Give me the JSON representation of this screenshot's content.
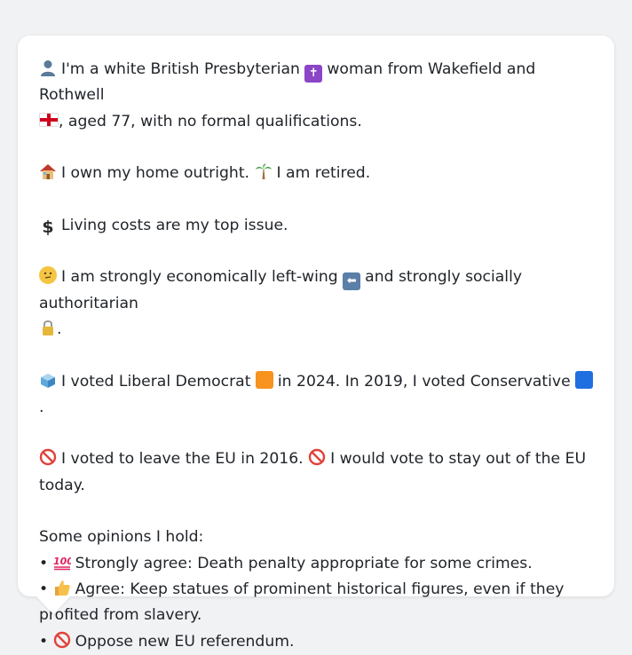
{
  "profile": {
    "line1": "I'm a white British Presbyterian",
    "line1b": "woman from Wakefield and Rothwell",
    "line1c": ", aged 77, with no formal qualifications.",
    "home": "I own my home outright.",
    "retired": "I am retired.",
    "issue": "Living costs are my top issue.",
    "econ": "I am strongly economically left-wing",
    "social": "and strongly socially authoritarian",
    "social_end": ".",
    "vote_a": "I voted Liberal Democrat",
    "vote_b": "in 2024. In 2019, I voted Conservative",
    "vote_end": ".",
    "eu_a": "I voted to leave the EU in 2016.",
    "eu_b": "I would vote to stay out of the EU today."
  },
  "opinions": {
    "heading": "Some opinions I hold:",
    "items": [
      {
        "prefix": "Strongly agree:",
        "text": "Death penalty appropriate for some crimes."
      },
      {
        "prefix": "Agree:",
        "text": "Keep statues of prominent historical figures, even if they profited from slavery."
      },
      {
        "prefix": "Oppose",
        "text": "new EU referendum."
      }
    ]
  },
  "icons": [
    "person-icon",
    "latin-cross-icon",
    "england-flag-icon",
    "house-icon",
    "palm-tree-icon",
    "dollar-icon",
    "thinking-face-icon",
    "left-arrow-icon",
    "lock-icon",
    "ballot-box-icon",
    "orange-square-icon",
    "blue-square-icon",
    "no-entry-icon",
    "hundred-points-icon",
    "thumbs-up-icon"
  ],
  "colors": {
    "background": "#f1f2f4",
    "card": "#ffffff",
    "text": "#1f2328",
    "lib_dem": "#f7931e",
    "conservative": "#1f6fe0"
  }
}
